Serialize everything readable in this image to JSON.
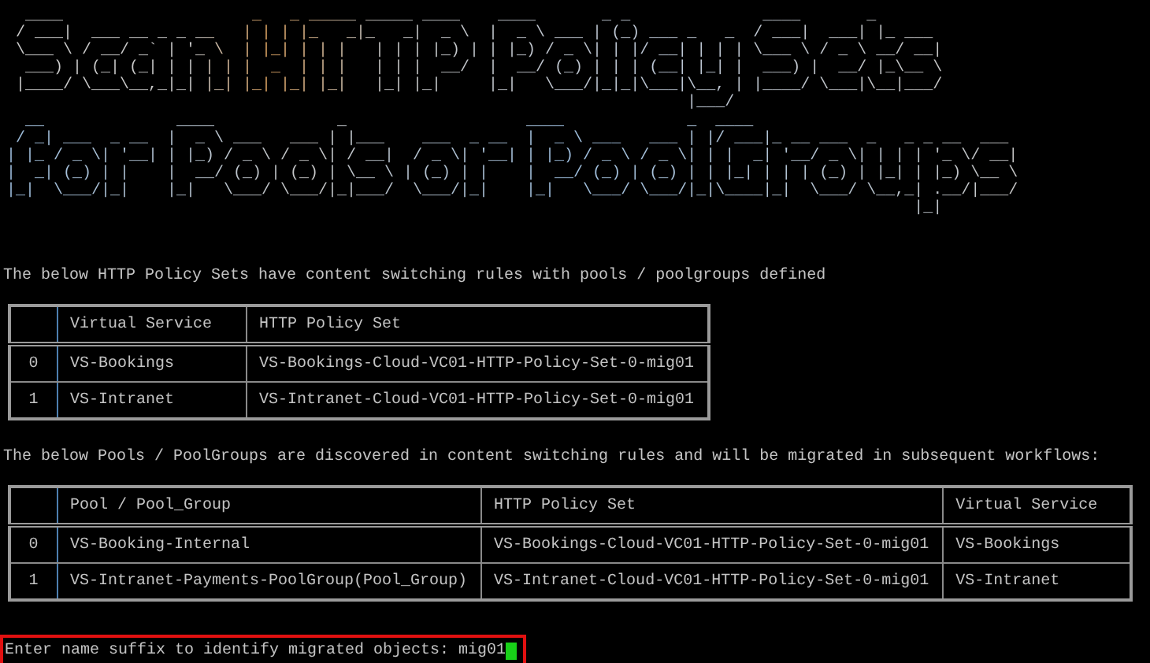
{
  "banners": [
    {
      "lines": [
        "  ____                    _   _ _____ _____ ____    ____       _ _              ____       _",
        " / ___|  ___ __ _ _ __   | | | |_   _|_   _|  _ \\  |  _ \\ ___ | (_) ___ _   _  / ___|  ___| |_ ___",
        " \\___ \\ / __/ _` | '_ \\  | |_| | | |   | | | |_) | | |_) / _ \\| | |/ __| | | | \\___ \\ / _ \\ __/ __|",
        "  ___) | (_| (_| | | | | |  _  | | |   | | |  __/  |  __/ (_) | | | (__| |_| |  ___) |  __/ |_\\__ \\",
        " |____/ \\___\\__,_|_| |_| |_| |_| |_|   |_| |_|     |_|   \\___/|_|_|\\___|\\__, | |____/ \\___|\\__|___/",
        "                                                                        |___/"
      ]
    },
    {
      "lines": [
        "  __              ____             _                   ____             _  ____",
        " / _| ___  _ __  |  _ \\ ___   ___ | |___    ___  _ __  |  _ \\ ___   ___ | |/ ___|_ __ ___  _   _ _ __  ___",
        "| |_ / _ \\| '__| | |_) / _ \\ / _ \\| / __|  / _ \\| '__| | |_) / _ \\ / _ \\| | |  _| '__/ _ \\| | | | '_ \\/ __|",
        "|  _| (_) | |    |  __/ (_) | (_) | \\__ \\ | (_) | |    |  __/ (_) | (_) | | |_| | | | (_) | |_| | |_) \\__ \\",
        "|_|  \\___/|_|    |_|   \\___/ \\___/|_|___/  \\___/|_|    |_|   \\___/ \\___/|_|\\____|_|  \\___/ \\__,_| .__/|___/",
        "                                                                                                |_|"
      ]
    }
  ],
  "sections": [
    {
      "intro": "The below HTTP Policy Sets have content switching rules with pools / poolgroups defined",
      "table": {
        "columns": [
          "",
          "Virtual Service",
          "HTTP Policy Set"
        ],
        "rows": [
          [
            "0",
            "VS-Bookings",
            "VS-Bookings-Cloud-VC01-HTTP-Policy-Set-0-mig01"
          ],
          [
            "1",
            "VS-Intranet",
            "VS-Intranet-Cloud-VC01-HTTP-Policy-Set-0-mig01"
          ]
        ]
      }
    },
    {
      "intro": "The below Pools / PoolGroups are discovered in content switching rules and will be migrated in subsequent workflows:",
      "table": {
        "columns": [
          "",
          "Pool / Pool_Group",
          "HTTP Policy Set",
          "Virtual Service"
        ],
        "rows": [
          [
            "0",
            "VS-Booking-Internal",
            "VS-Bookings-Cloud-VC01-HTTP-Policy-Set-0-mig01",
            "VS-Bookings"
          ],
          [
            "1",
            "VS-Intranet-Payments-PoolGroup(Pool_Group)",
            "VS-Intranet-Cloud-VC01-HTTP-Policy-Set-0-mig01",
            "VS-Intranet"
          ]
        ]
      }
    }
  ],
  "prompt": {
    "label": "Enter name suffix to identify migrated objects:",
    "value": "mig01"
  }
}
